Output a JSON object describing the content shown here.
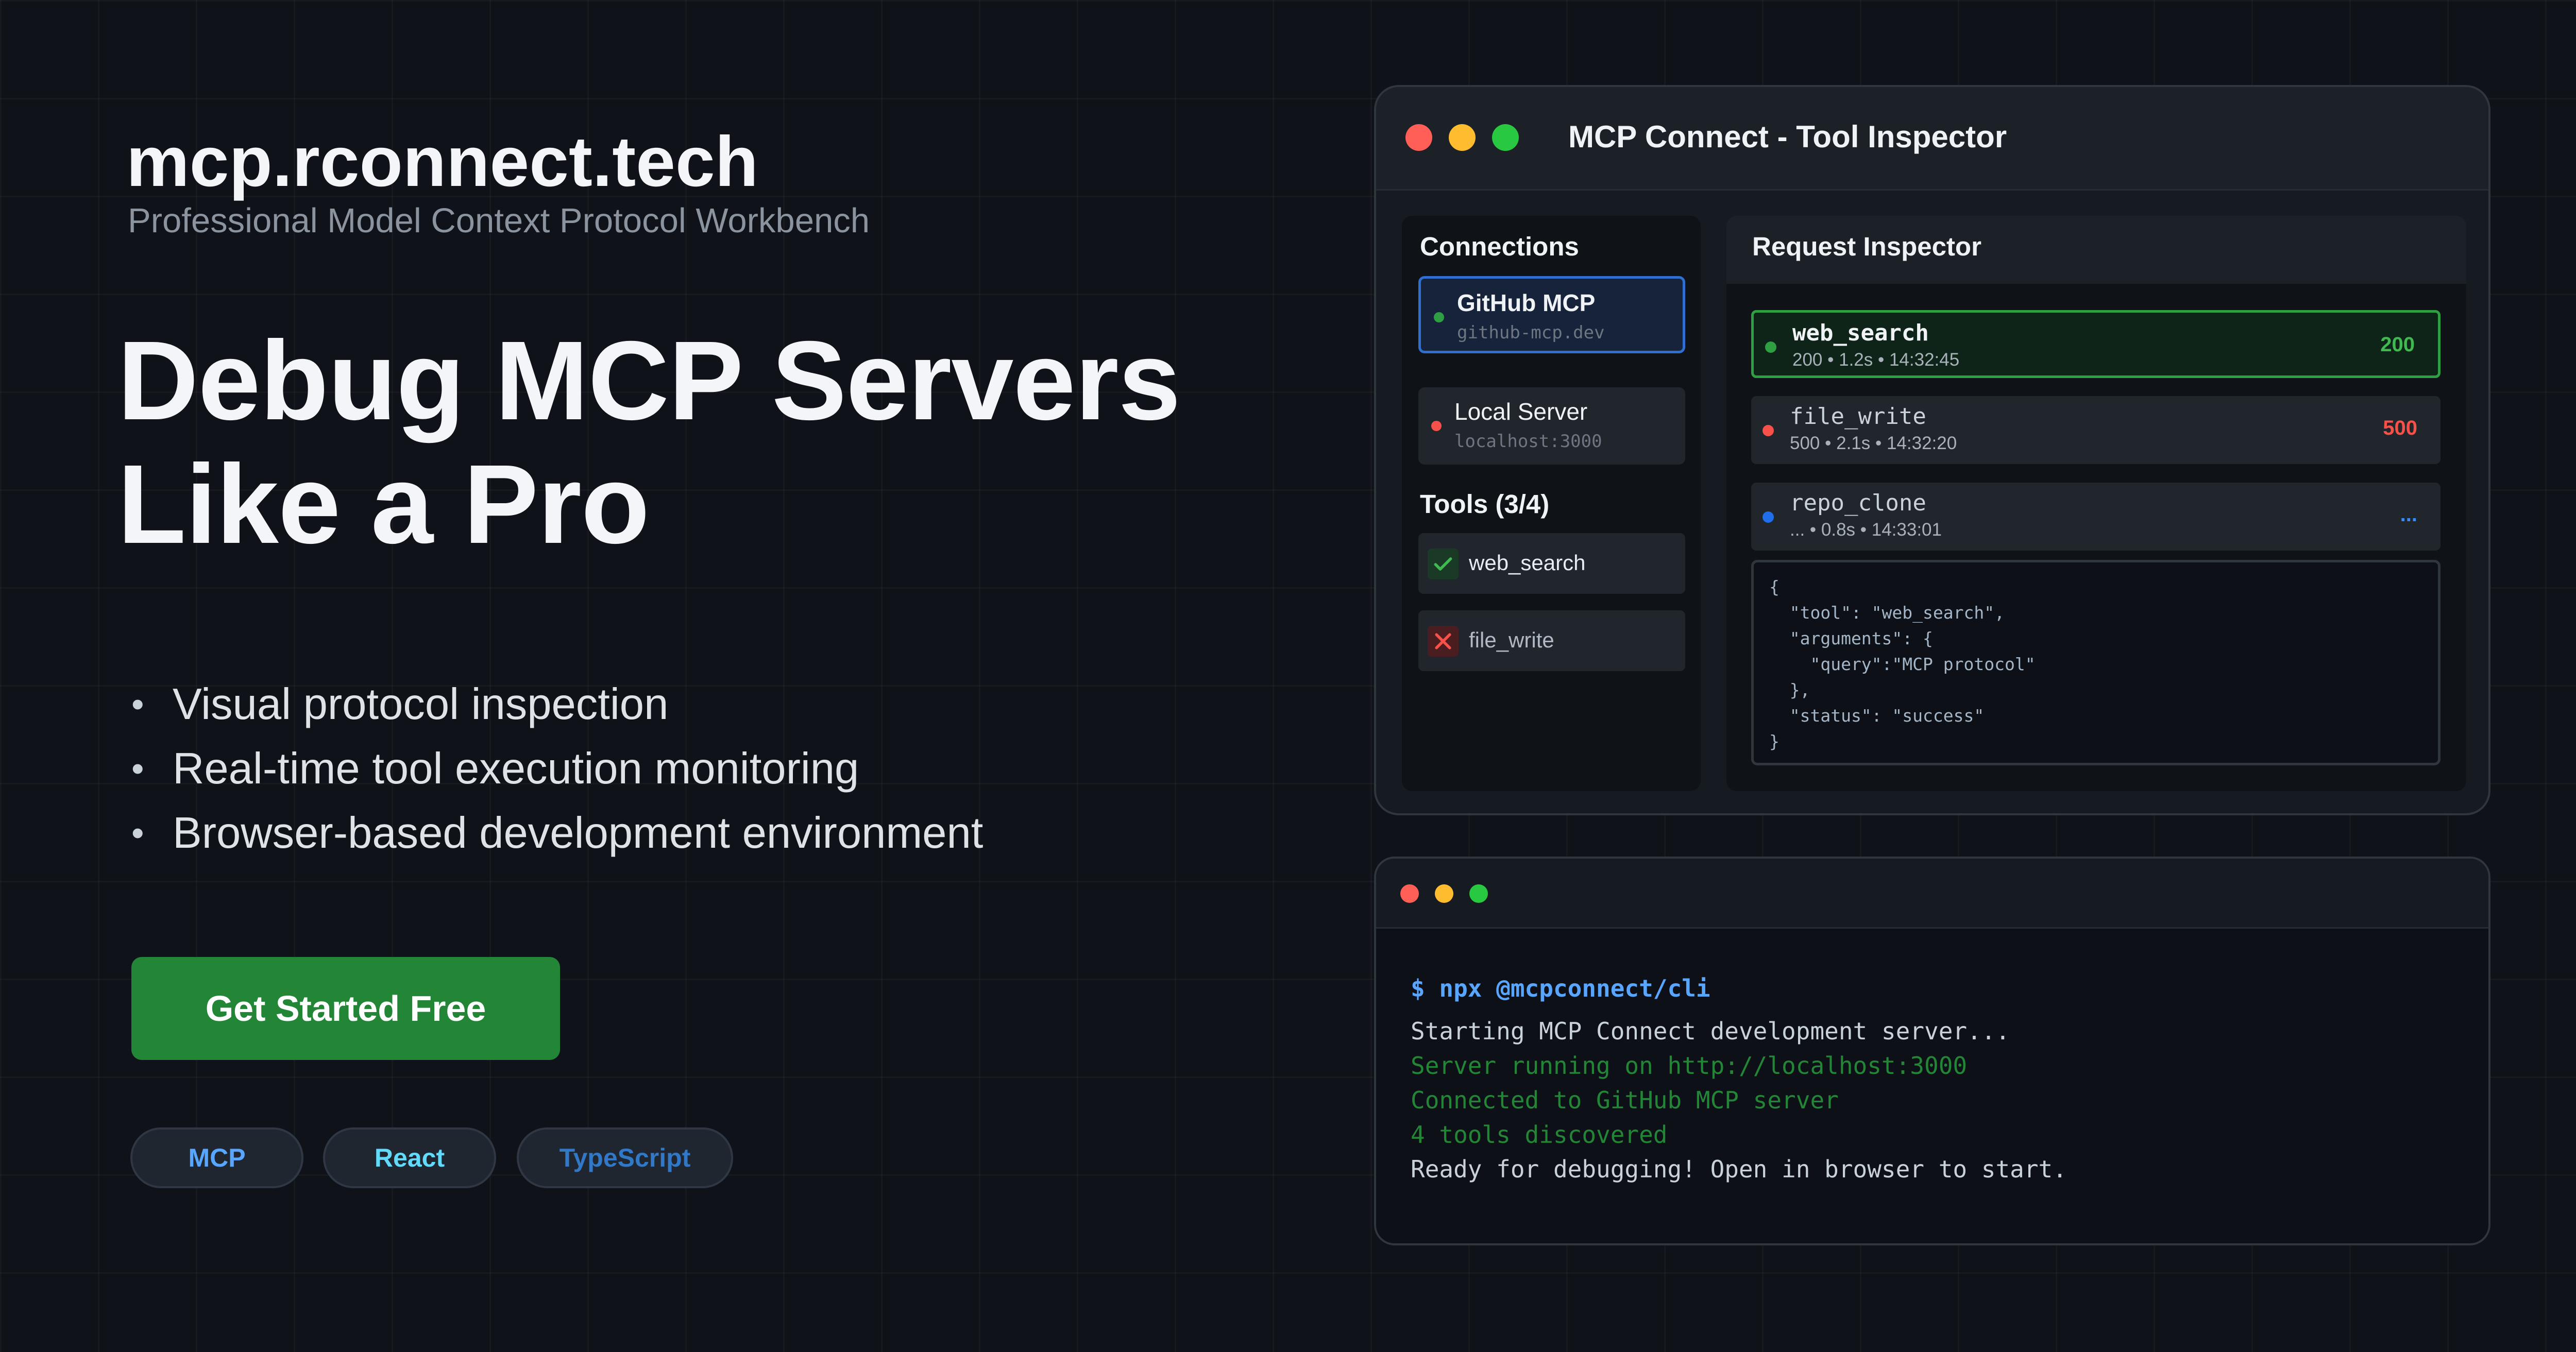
{
  "hero": {
    "site_title": "mcp.rconnect.tech",
    "site_subtitle": "Professional Model Context Protocol Workbench",
    "heading_line1": "Debug MCP Servers",
    "heading_line2": "Like a Pro",
    "features": [
      "Visual protocol inspection",
      "Real-time tool execution monitoring",
      "Browser-based development environment"
    ],
    "bullet": "•",
    "cta_label": "Get Started Free",
    "tags": [
      "MCP",
      "React",
      "TypeScript"
    ]
  },
  "inspector": {
    "title": "MCP Connect - Tool Inspector",
    "connections_heading": "Connections",
    "connections": [
      {
        "name": "GitHub MCP",
        "address": "github-mcp.dev",
        "status_color": "#2ea043"
      },
      {
        "name": "Local Server",
        "address": "localhost:3000",
        "status_color": "#f85149"
      }
    ],
    "tools_heading": "Tools (3/4)",
    "tools": [
      {
        "name": "web_search",
        "status": "success",
        "icon": "check-icon"
      },
      {
        "name": "file_write",
        "status": "error",
        "icon": "x-icon"
      }
    ],
    "request_heading": "Request Inspector",
    "requests": [
      {
        "name": "web_search",
        "meta": "200 • 1.2s • 14:32:45",
        "code": "200",
        "color": "#2ea043"
      },
      {
        "name": "file_write",
        "meta": "500 • 2.1s • 14:32:20",
        "code": "500",
        "color": "#f85149"
      },
      {
        "name": "repo_clone",
        "meta": "... • 0.8s • 14:33:01",
        "code": "...",
        "color": "#1f6feb"
      }
    ],
    "json_lines": [
      "{",
      "  \"tool\": \"web_search\",",
      "  \"arguments\": {",
      "    \"query\":\"MCP protocol\"",
      "  },",
      "  \"status\": \"success\"",
      "}"
    ]
  },
  "terminal": {
    "lines": [
      {
        "text": "$ npx @mcpconnect/cli",
        "kind": "command"
      },
      {
        "text": "Starting MCP Connect development server...",
        "kind": "plain"
      },
      {
        "text": "Server running on http://localhost:3000",
        "kind": "success"
      },
      {
        "text": "Connected to GitHub MCP server",
        "kind": "success"
      },
      {
        "text": "4 tools discovered",
        "kind": "success"
      },
      {
        "text": "Ready for debugging! Open in browser to start.",
        "kind": "plain"
      }
    ]
  },
  "colors": {
    "accent_green": "#238636",
    "success": "#2ea043",
    "error": "#f85149",
    "info": "#1f6feb",
    "traffic_red": "#ff5f57",
    "traffic_yellow": "#febc2e",
    "traffic_green": "#28c840"
  }
}
